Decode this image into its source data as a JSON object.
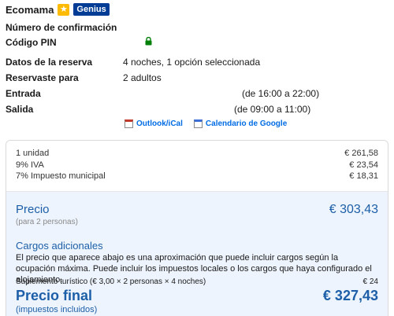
{
  "user": {
    "name": "Ecomama",
    "badge_icon": "star-icon",
    "badge_label": "Genius"
  },
  "details": {
    "confirmation_label": "Número de confirmación",
    "pin_label": "Código PIN",
    "pin_icon": "lock-icon",
    "reservation_label": "Datos de la reserva",
    "reservation_value": "4 noches, 1 opción seleccionada",
    "reserved_for_label": "Reservaste para",
    "reserved_for_value": "2 adultos",
    "checkin_label": "Entrada",
    "checkin_time": "(de 16:00 a 22:00)",
    "checkout_label": "Salida",
    "checkout_time": "(de 09:00 a 11:00)"
  },
  "calendar": {
    "outlook_label": "Outlook/iCal",
    "google_label": "Calendario de Google"
  },
  "price": {
    "lines": [
      {
        "label": "1 unidad",
        "amount": "€ 261,58"
      },
      {
        "label": "9% IVA",
        "amount": "€ 23,54"
      },
      {
        "label": "7% Impuesto municipal",
        "amount": "€ 18,31"
      }
    ],
    "precio_label": "Precio",
    "precio_amount": "€ 303,43",
    "precio_sub": "(para 2 personas)",
    "extra_title": "Cargos adicionales",
    "extra_desc": "El precio que aparece abajo es una aproximación que puede incluir cargos según la ocupación máxima. Puede incluir los impuestos locales o los cargos que haya configurado el alojamiento.",
    "suplemento_label": "Suplemento turístico  (€ 3,00 × 2 personas × 4 noches)",
    "suplemento_amount": "€ 24",
    "final_label": "Precio final",
    "final_amount": "€ 327,43",
    "final_sub": "(impuestos incluidos)"
  },
  "colors": {
    "link": "#006ce4",
    "price_blue": "#1c5fa8",
    "genius": "#003b95",
    "star": "#febb02",
    "lock": "#008009",
    "panel": "#edf4fd"
  }
}
